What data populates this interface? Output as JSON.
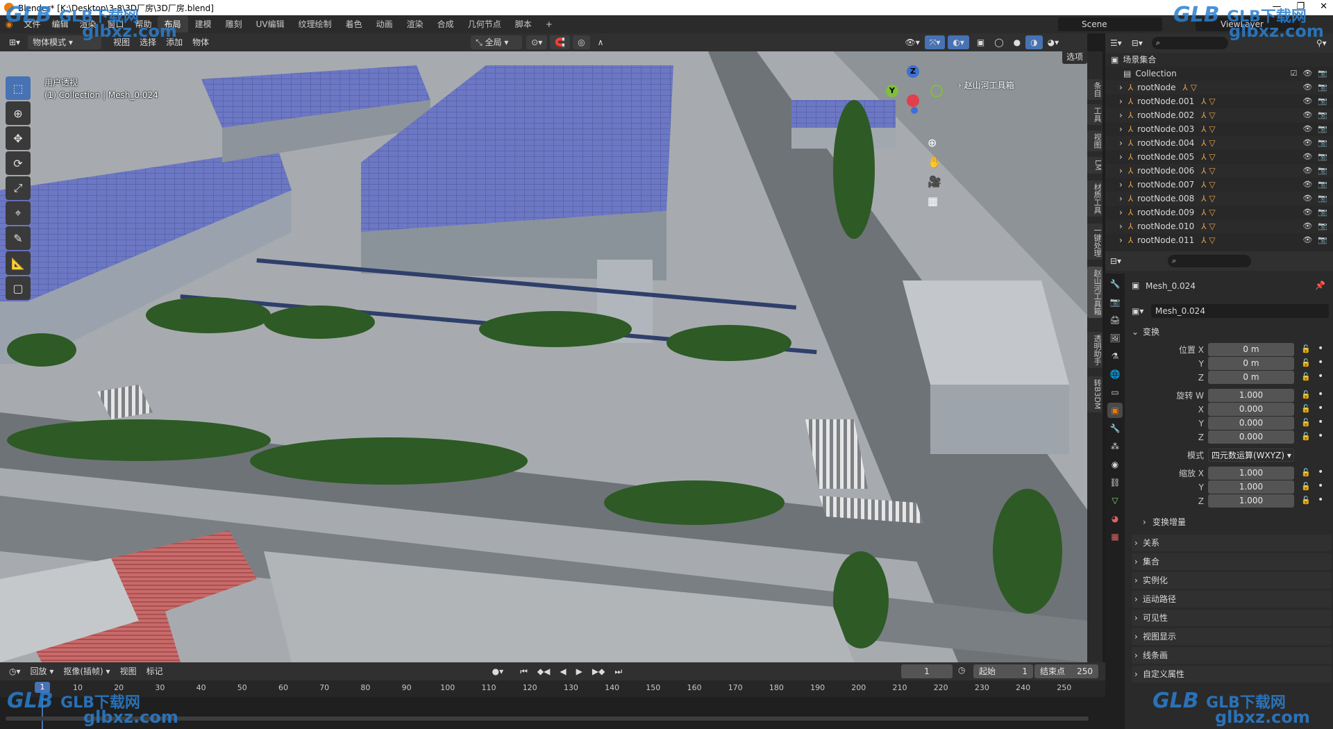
{
  "window": {
    "title": "Blender* [K:\\Desktop\\3-8\\3D厂房\\3D厂房.blend]",
    "controls": [
      "—",
      "❐",
      "✕"
    ]
  },
  "menubar": {
    "items": [
      "文件",
      "编辑",
      "渲染",
      "窗口",
      "帮助"
    ],
    "workspaces": [
      "布局",
      "建模",
      "雕刻",
      "UV编辑",
      "纹理绘制",
      "着色",
      "动画",
      "渲染",
      "合成",
      "几何节点",
      "脚本"
    ],
    "active_workspace": "布局",
    "add_tab": "+",
    "scene": "Scene",
    "view_layer": "ViewLayer"
  },
  "viewport_header": {
    "mode": "物体模式",
    "menus": [
      "视图",
      "选择",
      "添加",
      "物体"
    ],
    "transform_orientation": "全局",
    "options": "选项"
  },
  "viewport": {
    "perspective": "用户透视",
    "collection_info": "(1) Collection | Mesh_0.024",
    "toolbox_label": "赵山河工具箱",
    "gizmo_axes": {
      "z": "Z",
      "y": "Y",
      "x": "X"
    }
  },
  "sidetabs": [
    "条目",
    "工具",
    "视图",
    "LM",
    "材质工具",
    "一键处理",
    "赵山河工具箱",
    "透明助手",
    "转B3DM"
  ],
  "outliner": {
    "scene_collection": "场景集合",
    "collection": "Collection",
    "items": [
      "rootNode",
      "rootNode.001",
      "rootNode.002",
      "rootNode.003",
      "rootNode.004",
      "rootNode.005",
      "rootNode.006",
      "rootNode.007",
      "rootNode.008",
      "rootNode.009",
      "rootNode.010",
      "rootNode.011"
    ]
  },
  "properties": {
    "object_name": "Mesh_0.024",
    "data_name": "Mesh_0.024",
    "transform_header": "变换",
    "location_label": "位置 X",
    "location": [
      "0 m",
      "0 m",
      "0 m"
    ],
    "rotation_label": "旋转 W",
    "rotation": [
      "1.000",
      "0.000",
      "0.000",
      "0.000"
    ],
    "mode_label": "模式",
    "rotation_mode": "四元数运算(WXYZ)",
    "scale_label": "缩放 X",
    "scale": [
      "1.000",
      "1.000",
      "1.000"
    ],
    "axis_labels": [
      "Y",
      "Z",
      "X"
    ],
    "delta_transform": "变换增量",
    "panels": [
      "关系",
      "集合",
      "实例化",
      "运动路径",
      "可见性",
      "视图显示",
      "线条画",
      "自定义属性"
    ]
  },
  "timeline": {
    "menus": [
      "回放",
      "抠像(插帧)",
      "视图",
      "标记"
    ],
    "current_frame": "1",
    "start_label": "起始",
    "start": "1",
    "end_label": "结束点",
    "end": "250",
    "ticks": [
      "10",
      "20",
      "30",
      "40",
      "50",
      "60",
      "70",
      "80",
      "90",
      "100",
      "110",
      "120",
      "130",
      "140",
      "150",
      "160",
      "170",
      "180",
      "190",
      "200",
      "210",
      "220",
      "230",
      "240",
      "250"
    ],
    "cursor_frame": "1"
  },
  "watermark": {
    "brand": "GLB下载网",
    "url": "glbxz.com",
    "logo": "GLB"
  },
  "colors": {
    "accent": "#4772b3",
    "blender_orange": "#e87d0d",
    "watermark_blue": "#1f8ee6"
  }
}
